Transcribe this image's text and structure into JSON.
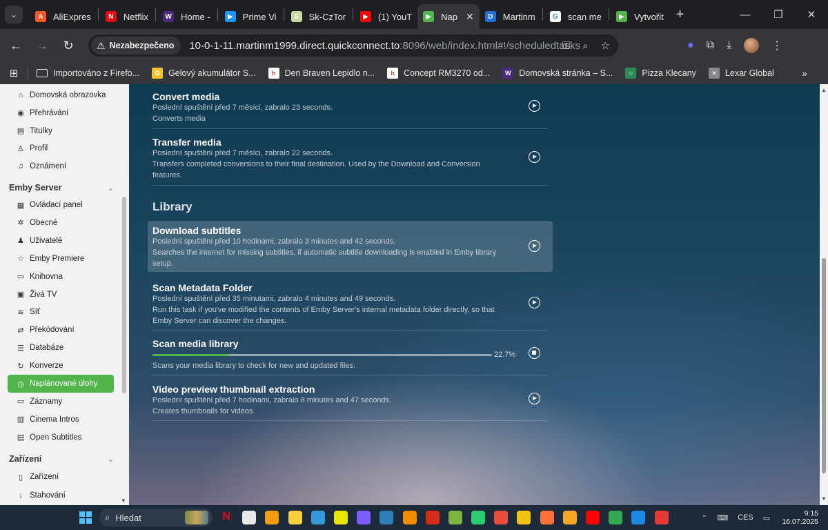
{
  "browser": {
    "tabs": [
      {
        "title": "AliExpres",
        "icon": "aliexpress-icon",
        "color": "#ff5722",
        "glyph": "A"
      },
      {
        "title": "Netflix",
        "icon": "netflix-icon",
        "color": "#e50914",
        "glyph": "N"
      },
      {
        "title": "Home - ",
        "icon": "wd-icon",
        "color": "#4a2a7a",
        "glyph": "W"
      },
      {
        "title": "Prime Vi",
        "icon": "prime-video-icon",
        "color": "#1a98ff",
        "glyph": "▶"
      },
      {
        "title": "Sk-CzTor",
        "icon": "torrent-icon",
        "color": "#c8d8a0",
        "glyph": "S"
      },
      {
        "title": "(1) YouT",
        "icon": "youtube-icon",
        "color": "#ff0000",
        "glyph": "▶"
      },
      {
        "title": "Nap",
        "icon": "emby-icon",
        "color": "#52b54b",
        "glyph": "▶",
        "active": true
      },
      {
        "title": "Martinm",
        "icon": "dsm-icon",
        "color": "#1f6fd6",
        "glyph": "D"
      },
      {
        "title": "scan me",
        "icon": "google-icon",
        "color": "#ffffff",
        "glyph": "G"
      },
      {
        "title": "Vytvořit",
        "icon": "emby-icon",
        "color": "#52b54b",
        "glyph": "▶"
      }
    ],
    "address": {
      "security_label": "Nezabezpečeno",
      "url_host": "10-0-1-11.martinm1999.direct.quickconnect.to",
      "url_rest": ":8096/web/index.html#!/scheduledtasks"
    },
    "bookmarks": [
      {
        "label": "Importováno z Firefo...",
        "icon": "folder-icon",
        "color": "#f1f1f1",
        "glyph": "▭"
      },
      {
        "label": "Gelový akumulátor S...",
        "icon": "shop-icon",
        "color": "#f4c430",
        "glyph": "G"
      },
      {
        "label": "Den Braven Lepidlo n...",
        "icon": "heureka-icon",
        "color": "#ffffff",
        "glyph": "h"
      },
      {
        "label": "Concept RM3270 od...",
        "icon": "heureka-icon",
        "color": "#ffffff",
        "glyph": "h"
      },
      {
        "label": "Domovská stránka – S...",
        "icon": "wd-icon",
        "color": "#4a2a7a",
        "glyph": "W"
      },
      {
        "label": "Pizza Klecany",
        "icon": "pizza-icon",
        "color": "#2e8b57",
        "glyph": "○"
      },
      {
        "label": "Lexar Global",
        "icon": "lexar-icon",
        "color": "#888888",
        "glyph": "✕"
      }
    ]
  },
  "sidebar": {
    "top_items": [
      {
        "label": "Domovská obrazovka",
        "icon": "home-icon",
        "glyph": "⌂"
      },
      {
        "label": "Přehrávání",
        "icon": "play-circle-icon",
        "glyph": "◉"
      },
      {
        "label": "Titulky",
        "icon": "subtitles-icon",
        "glyph": "▤"
      },
      {
        "label": "Profil",
        "icon": "person-icon",
        "glyph": "♙"
      },
      {
        "label": "Oznámení",
        "icon": "bell-icon",
        "glyph": "♫"
      }
    ],
    "server_heading": "Emby Server",
    "server_items": [
      {
        "label": "Ovládací panel",
        "icon": "dashboard-icon",
        "glyph": "▦"
      },
      {
        "label": "Obecné",
        "icon": "settings-icon",
        "glyph": "✲"
      },
      {
        "label": "Uživatelé",
        "icon": "users-icon",
        "glyph": "♟"
      },
      {
        "label": "Emby Premiere",
        "icon": "star-icon",
        "glyph": "☆"
      },
      {
        "label": "Knihovna",
        "icon": "folder-icon",
        "glyph": "▭"
      },
      {
        "label": "Živá TV",
        "icon": "tv-icon",
        "glyph": "▣"
      },
      {
        "label": "Síť",
        "icon": "wifi-icon",
        "glyph": "≋"
      },
      {
        "label": "Překódování",
        "icon": "transcode-icon",
        "glyph": "⇄"
      },
      {
        "label": "Databáze",
        "icon": "database-icon",
        "glyph": "☰"
      },
      {
        "label": "Konverze",
        "icon": "convert-icon",
        "glyph": "↻"
      },
      {
        "label": "Naplánované úlohy",
        "icon": "clock-icon",
        "glyph": "◷",
        "active": true
      },
      {
        "label": "Záznamy",
        "icon": "logs-icon",
        "glyph": "▭"
      },
      {
        "label": "Cinema Intros",
        "icon": "film-icon",
        "glyph": "▥"
      },
      {
        "label": "Open Subtitles",
        "icon": "subtitles-icon",
        "glyph": "▤"
      }
    ],
    "devices_heading": "Zařízení",
    "device_items": [
      {
        "label": "Zařízení",
        "icon": "devices-icon",
        "glyph": "▯"
      },
      {
        "label": "Stahování",
        "icon": "download-icon",
        "glyph": "↓"
      }
    ]
  },
  "tasks_top": [
    {
      "title": "Convert media",
      "last_run": "Poslední spuštění před 7 měsíci, zabralo 23 seconds.",
      "desc": [
        "Converts media"
      ]
    },
    {
      "title": "Transfer media",
      "last_run": "Poslední spuštění před 7 měsíci, zabralo 22 seconds.",
      "desc": [
        "Transfers completed conversions to their final destination. Used by the Download and Conversion",
        "features."
      ]
    }
  ],
  "library": {
    "heading": "Library",
    "tasks": [
      {
        "title": "Download subtitles",
        "last_run": "Poslední spuštění před 10 hodinami, zabralo 3 minutes and 42 seconds.",
        "desc": [
          "Searches the internet for missing subtitles, if automatic subtitle downloading is enabled in Emby library",
          "setup."
        ]
      },
      {
        "title": "Scan Metadata Folder",
        "last_run": "Poslední spuštění před 35 minutami, zabralo 4 minutes and 49 seconds.",
        "desc": [
          "Run this task if you've modified the contents of Emby Server's internal metadata folder directly, so that",
          "Emby Server can discover the changes."
        ]
      },
      {
        "title": "Scan media library",
        "progress": 22.7,
        "progress_label": "22.7%",
        "desc": [
          "Scans your media library to check for new and updated files."
        ]
      },
      {
        "title": "Video preview thumbnail extraction",
        "last_run": "Poslední spuštění před 7 hodinami, zabralo 8 minutes and 47 seconds.",
        "desc": [
          "Creates thumbnails for videos."
        ]
      }
    ]
  },
  "taskbar": {
    "search_placeholder": "Hledat",
    "apps": [
      "#e50914",
      "#e8e8e8",
      "#f39c12",
      "#f4d03f",
      "#3498db",
      "#e6e600",
      "#7d5fff",
      "#2f7fb8",
      "#f08c00",
      "#d62c1a",
      "#7cb342",
      "#2ecc71",
      "#e74c3c",
      "#f1c40f",
      "#ff7139",
      "#f5a623",
      "#ff0000",
      "#34a853",
      "#1e88e5",
      "#e53935"
    ],
    "lang": "CES",
    "time": "9:15",
    "date": "16.07.2025"
  },
  "accent": "#52b54b"
}
